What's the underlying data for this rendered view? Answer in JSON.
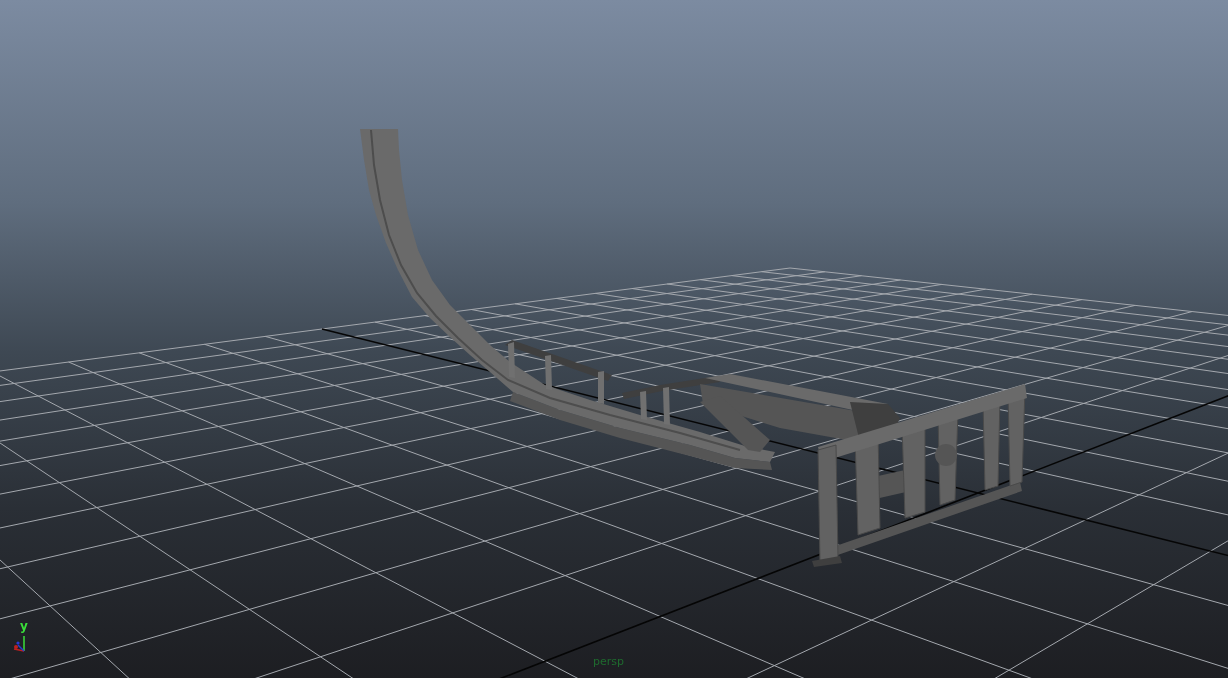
{
  "viewport": {
    "camera_label": "persp",
    "axis_gizmo": {
      "up_axis_label": "y"
    }
  }
}
